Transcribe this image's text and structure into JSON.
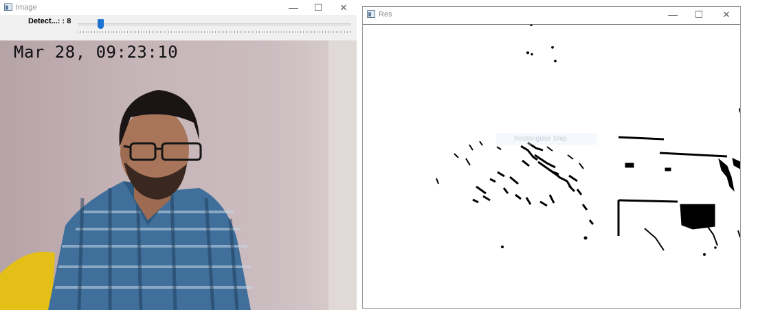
{
  "image_window": {
    "title": "Image",
    "trackbar": {
      "label": "Detect...: : 8",
      "value": 8
    },
    "timestamp": "Mar 28, 09:23:10"
  },
  "res_window": {
    "title": "Res",
    "ghost_menu_text": "Rectangular Snip"
  },
  "caption_buttons": {
    "minimize": "—",
    "maximize": "☐",
    "close": "✕"
  },
  "colors": {
    "slider_thumb": "#1e74d0",
    "shirt_blue": "#3f6f9a",
    "chair_yellow": "#e3bf18"
  }
}
